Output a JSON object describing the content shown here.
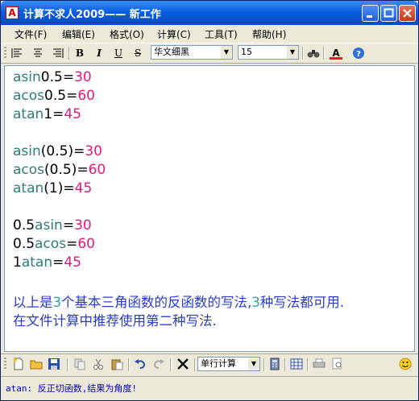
{
  "window": {
    "title": "计算不求人2009——  新工作",
    "app_icon_text": "A"
  },
  "menu": [
    "文件(F)",
    "编辑(E)",
    "格式(O)",
    "计算(C)",
    "工具(T)",
    "帮助(H)"
  ],
  "format_toolbar": {
    "bold": "B",
    "italic": "I",
    "underline": "U",
    "strike": "S",
    "font_name": "华文细黑",
    "font_size": "15",
    "font_color_letter": "A"
  },
  "editor": {
    "lines": [
      [
        {
          "t": "asin",
          "c": "fn"
        },
        {
          "t": "0.5",
          "c": "num"
        },
        {
          "t": "=",
          "c": "num"
        },
        {
          "t": "30",
          "c": "res"
        }
      ],
      [
        {
          "t": "acos",
          "c": "fn"
        },
        {
          "t": "0.5",
          "c": "num"
        },
        {
          "t": "=",
          "c": "num"
        },
        {
          "t": "60",
          "c": "res"
        }
      ],
      [
        {
          "t": "atan",
          "c": "fn"
        },
        {
          "t": "1",
          "c": "num"
        },
        {
          "t": "=",
          "c": "num"
        },
        {
          "t": "45",
          "c": "res"
        }
      ],
      [],
      [
        {
          "t": "asin",
          "c": "fn"
        },
        {
          "t": "(0.5)",
          "c": "num"
        },
        {
          "t": "=",
          "c": "num"
        },
        {
          "t": "30",
          "c": "res"
        }
      ],
      [
        {
          "t": "acos",
          "c": "fn"
        },
        {
          "t": "(0.5)",
          "c": "num"
        },
        {
          "t": "=",
          "c": "num"
        },
        {
          "t": "60",
          "c": "res"
        }
      ],
      [
        {
          "t": "atan",
          "c": "fn"
        },
        {
          "t": "(1)",
          "c": "num"
        },
        {
          "t": "=",
          "c": "num"
        },
        {
          "t": "45",
          "c": "res"
        }
      ],
      [],
      [
        {
          "t": "0.5",
          "c": "num"
        },
        {
          "t": "asin",
          "c": "fn"
        },
        {
          "t": "=",
          "c": "num"
        },
        {
          "t": "30",
          "c": "res"
        }
      ],
      [
        {
          "t": "0.5",
          "c": "num"
        },
        {
          "t": "acos",
          "c": "fn"
        },
        {
          "t": "=",
          "c": "num"
        },
        {
          "t": "60",
          "c": "res"
        }
      ],
      [
        {
          "t": "1",
          "c": "num"
        },
        {
          "t": "atan",
          "c": "fn"
        },
        {
          "t": "=",
          "c": "num"
        },
        {
          "t": "45",
          "c": "res"
        }
      ],
      [],
      [
        {
          "t": "以上是",
          "c": "cjk"
        },
        {
          "t": "3",
          "c": "res3"
        },
        {
          "t": "个基本三角函数的反函数的写法,",
          "c": "cjk"
        },
        {
          "t": "3",
          "c": "res3"
        },
        {
          "t": "种写法都可用.",
          "c": "cjk"
        }
      ],
      [
        {
          "t": "在文件计算中推荐使用第二种写法.",
          "c": "cjk"
        }
      ]
    ]
  },
  "bottom_toolbar": {
    "mode_select": "单行计算"
  },
  "status": {
    "text": "atan: 反正切函数,结果为角度!"
  },
  "colors": {
    "function": "#2e7d7b",
    "result": "#e01a7a",
    "note": "#2a3bc8"
  }
}
